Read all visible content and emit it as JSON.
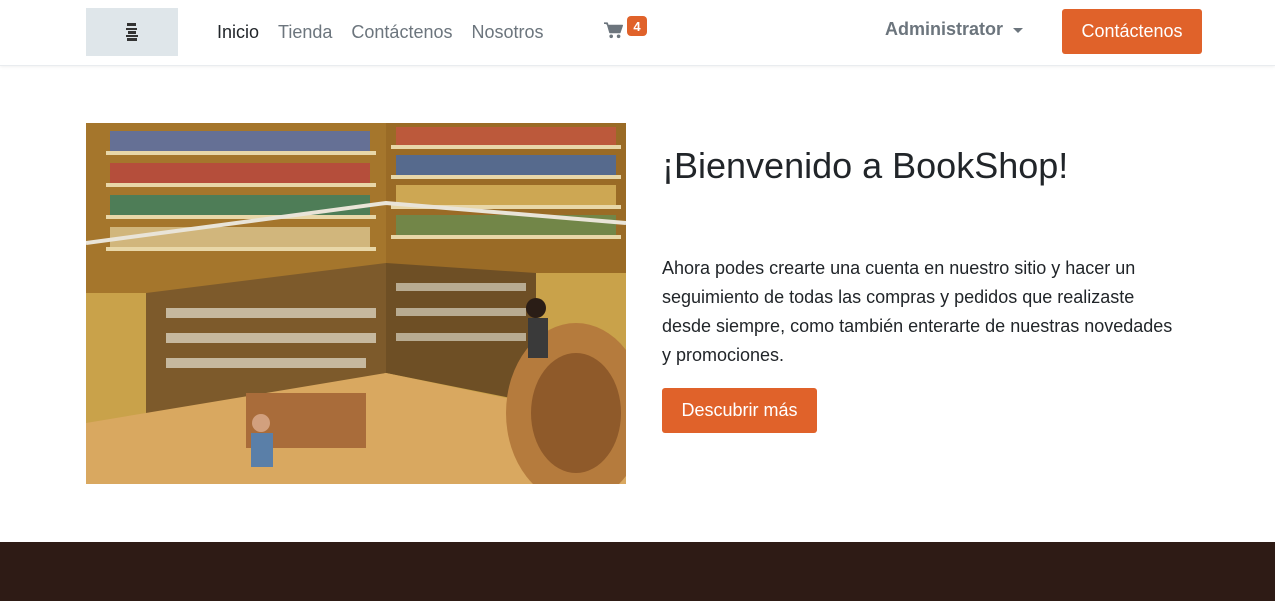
{
  "header": {
    "logo_icon": "bookshop-logo-icon",
    "nav": [
      {
        "label": "Inicio",
        "active": true
      },
      {
        "label": "Tienda",
        "active": false
      },
      {
        "label": "Contáctenos",
        "active": false
      },
      {
        "label": "Nosotros",
        "active": false
      }
    ],
    "cart": {
      "icon": "shopping-cart-icon",
      "count": "4"
    },
    "user": {
      "name": "Administrator",
      "icon": "caret-down-icon"
    },
    "cta_label": "Contáctenos"
  },
  "hero": {
    "image": "bookstore-interior-photo",
    "title": "¡Bienvenido a BookShop!",
    "text": "Ahora podes crearte una cuenta en nuestro sitio y hacer un seguimiento de todas las compras y pedidos que realizaste desde siempre, como también enterarte de nuestras novedades y promociones.",
    "cta_label": "Descubrir más"
  },
  "colors": {
    "accent": "#e0622a",
    "footer": "#2e1b15",
    "nav_text": "#6c757d",
    "nav_active": "#212529"
  }
}
